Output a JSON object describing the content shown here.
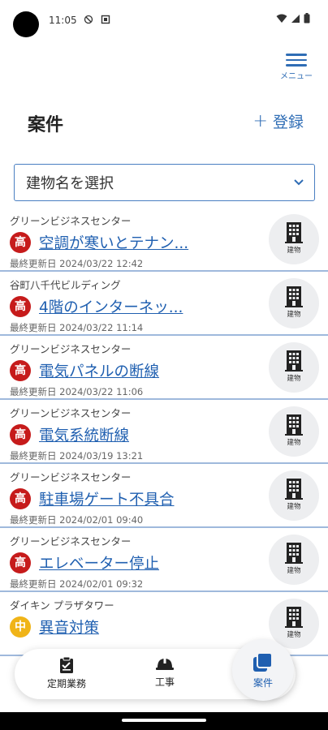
{
  "status": {
    "time": "11:05"
  },
  "header": {
    "menu_label": "メニュー",
    "title": "案件",
    "register_label": "登録"
  },
  "filter": {
    "placeholder": "建物名を選択"
  },
  "building_icon_caption": "建物",
  "items": [
    {
      "building": "グリーンビジネスセンター",
      "priority": "高",
      "title": "空調が寒いとテナン...",
      "updated": "最終更新日 2024/03/22 12:42"
    },
    {
      "building": "谷町八千代ビルディング",
      "priority": "高",
      "title": "4階のインターネッ...",
      "updated": "最終更新日 2024/03/22 11:14"
    },
    {
      "building": "グリーンビジネスセンター",
      "priority": "高",
      "title": "電気パネルの断線",
      "updated": "最終更新日 2024/03/22 11:06"
    },
    {
      "building": "グリーンビジネスセンター",
      "priority": "高",
      "title": "電気系統断線",
      "updated": "最終更新日 2024/03/19 13:21"
    },
    {
      "building": "グリーンビジネスセンター",
      "priority": "高",
      "title": "駐車場ゲート不具合",
      "updated": "最終更新日 2024/02/01 09:40"
    },
    {
      "building": "グリーンビジネスセンター",
      "priority": "高",
      "title": "エレベーター停止",
      "updated": "最終更新日 2024/02/01 09:32"
    },
    {
      "building": "ダイキン プラザタワー",
      "priority": "中",
      "title": "異音対策",
      "updated": ""
    }
  ],
  "nav": {
    "routine_label": "定期業務",
    "construction_label": "工事",
    "cases_label": "案件"
  },
  "colors": {
    "accent": "#2f6db5",
    "link": "#1f5fb0",
    "priority_high": "#c61b1b",
    "priority_mid": "#f0b418"
  }
}
